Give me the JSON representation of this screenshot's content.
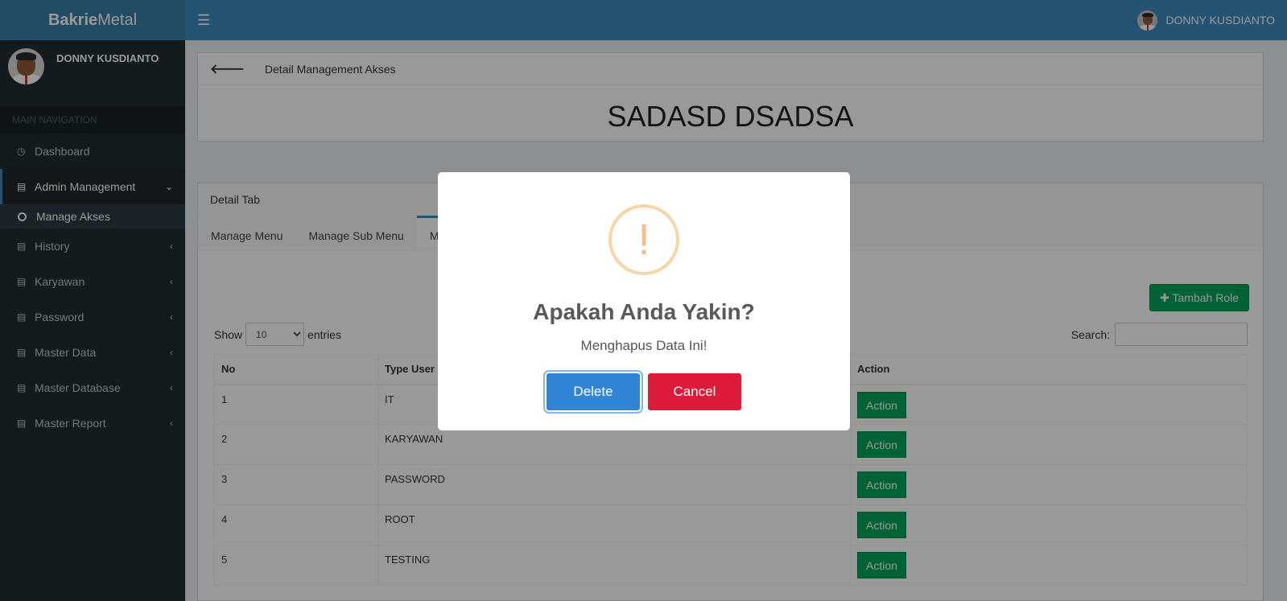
{
  "app": {
    "logo_bold": "Bakrie",
    "logo_light": "Metal",
    "menu_icon": "☰"
  },
  "user": {
    "name": "DONNY KUSDIANTO"
  },
  "sidebar": {
    "header": "MAIN NAVIGATION",
    "items": [
      {
        "label": "Dashboard",
        "icon": "dashboard-icon"
      },
      {
        "label": "Admin Management",
        "icon": "book-icon"
      },
      {
        "label": "History",
        "icon": "book-icon"
      },
      {
        "label": "Karyawan",
        "icon": "book-icon"
      },
      {
        "label": "Password",
        "icon": "book-icon"
      },
      {
        "label": "Master Data",
        "icon": "book-icon"
      },
      {
        "label": "Master Database",
        "icon": "book-icon"
      },
      {
        "label": "Master Report",
        "icon": "book-icon"
      }
    ],
    "sub_items": [
      {
        "label": "Manage Akses"
      }
    ]
  },
  "detail": {
    "breadcrumb": "Detail Management Akses",
    "title": "SADASD DSADSA"
  },
  "tabbox": {
    "header": "Detail Tab",
    "tabs": [
      {
        "label": "Manage Menu"
      },
      {
        "label": "Manage Sub Menu"
      },
      {
        "label": "Manage Role"
      }
    ],
    "add_button": "Tambah Role",
    "show_label": "Show",
    "entries_value": "10",
    "entries_label": "entries",
    "search_label": "Search:"
  },
  "table": {
    "columns": [
      "No",
      "Type User",
      "Action"
    ],
    "rows": [
      {
        "no": "1",
        "type": "IT",
        "action": "Action"
      },
      {
        "no": "2",
        "type": "KARYAWAN",
        "action": "Action"
      },
      {
        "no": "3",
        "type": "PASSWORD",
        "action": "Action"
      },
      {
        "no": "4",
        "type": "ROOT",
        "action": "Action"
      },
      {
        "no": "5",
        "type": "TESTING",
        "action": "Action"
      }
    ]
  },
  "modal": {
    "icon": "!",
    "title": "Apakah Anda Yakin?",
    "text": "Menghapus Data Ini!",
    "confirm": "Delete",
    "cancel": "Cancel"
  },
  "colors": {
    "brand": "#3c8dbc",
    "success": "#00a65a",
    "danger": "#dd1c3b",
    "confirm": "#3085d6",
    "warning": "#f8bb86"
  }
}
